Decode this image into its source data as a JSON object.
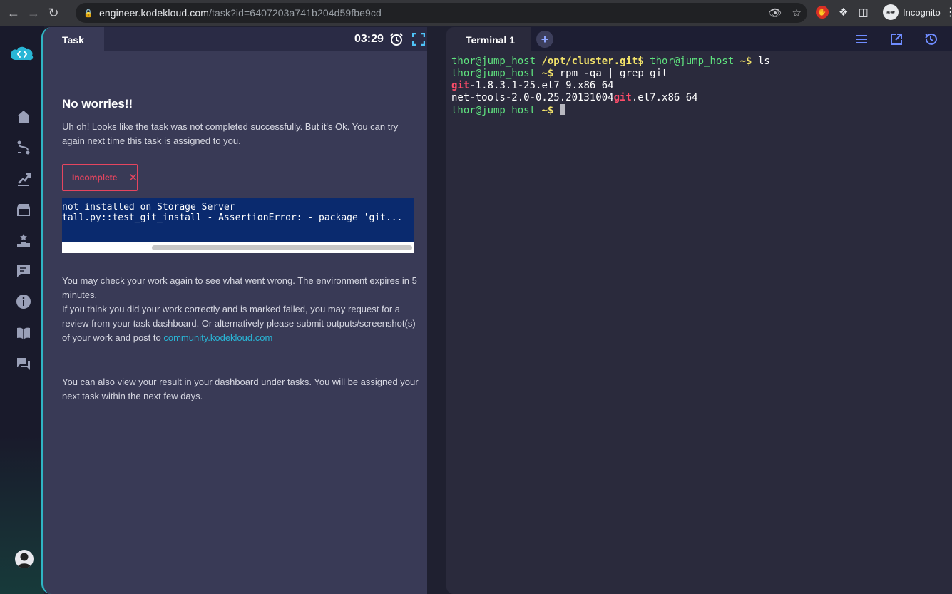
{
  "browser": {
    "url_host": "engineer.kodekloud.com",
    "url_path": "/task?id=6407203a741b204d59fbe9cd",
    "profile_label": "Incognito"
  },
  "sidebar": {
    "items": [
      {
        "icon": "home-icon"
      },
      {
        "icon": "route-icon"
      },
      {
        "icon": "growth-icon"
      },
      {
        "icon": "store-icon"
      },
      {
        "icon": "leaderboard-icon"
      },
      {
        "icon": "feedback-icon"
      },
      {
        "icon": "info-icon"
      },
      {
        "icon": "book-icon"
      },
      {
        "icon": "chat-icon"
      }
    ]
  },
  "task": {
    "tab_label": "Task",
    "timer": "03:29",
    "heading": "No worries!!",
    "intro": "Uh oh! Looks like the task was not completed successfully. But it's Ok. You can try again next time this task is assigned to you.",
    "status_badge": "Incomplete",
    "error_lines": [
      "not installed on Storage Server",
      "tall.py::test_git_install - AssertionError: - package 'git..."
    ],
    "check_again": "You may check your work again to see what went wrong. The environment expires in 5 minutes.",
    "review_text": "If you think you did your work correctly and is marked failed, you may request for a review from your task dashboard. Or alternatively please submit outputs/screenshot(s) of your work and post to ",
    "community_link": "community.kodekloud.com",
    "dashboard_note": "You can also view your result in your dashboard under tasks. You will be assigned your next task within the next few days."
  },
  "terminal": {
    "tab_label": "Terminal 1",
    "add_label": "+",
    "line1_user": "thor@jump_host",
    "line1_path": " /opt/cluster.git$",
    "line1_user2": " thor@jump_host",
    "line1_prompt": " ~$",
    "line1_cmd": " ls",
    "line2_user": "thor@jump_host",
    "line2_prompt": " ~$",
    "line2_cmd": " rpm -qa | grep git",
    "line3_match": "git",
    "line3_rest": "-1.8.3.1-25.el7_9.x86_64",
    "line4_pre": "net-tools-2.0-0.25.20131004",
    "line4_match": "git",
    "line4_rest": ".el7.x86_64",
    "line5_user": "thor@jump_host",
    "line5_prompt": " ~$",
    "line5_cmd": " "
  },
  "colors": {
    "accent": "#2fb5c4",
    "panel": "#393a56",
    "error_red": "#e6455f",
    "prompt_green": "#5fe37f",
    "prompt_yellow": "#f3e36a",
    "match_red": "#ff4d6a"
  }
}
